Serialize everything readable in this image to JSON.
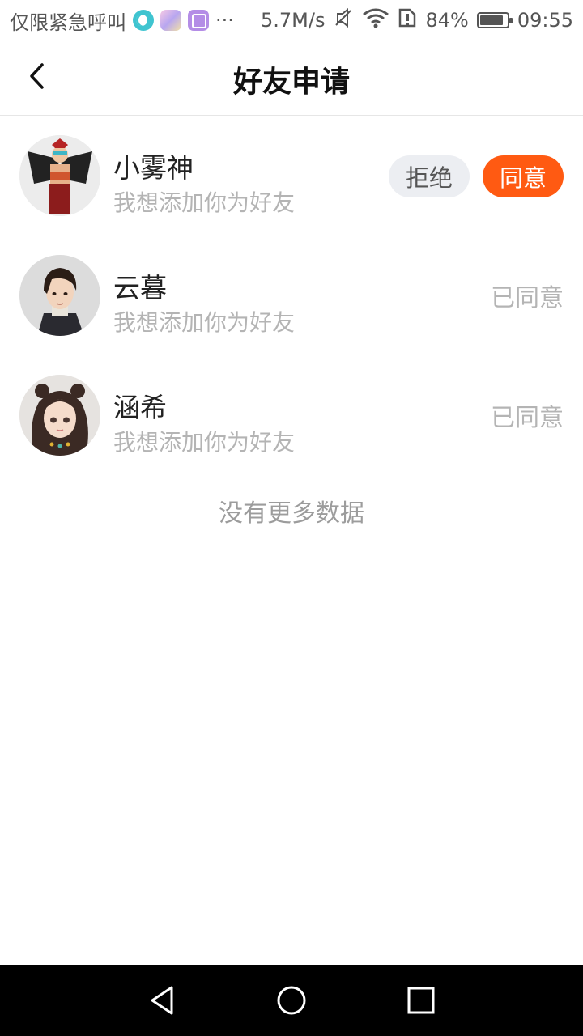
{
  "status_bar": {
    "carrier_text": "仅限紧急呼叫",
    "more_dots": "···",
    "speed": "5.7M/s",
    "battery_percent": "84%",
    "time": "09:55",
    "icons": [
      "moon-app-icon",
      "game-app-icon",
      "gallery-app-icon",
      "mute-icon",
      "wifi-icon",
      "sim-alert-icon",
      "battery-icon"
    ]
  },
  "header": {
    "title": "好友申请",
    "back_icon": "chevron-left-icon"
  },
  "requests": [
    {
      "name": "小雾神",
      "message": "我想添加你为好友",
      "state": "pending",
      "reject_label": "拒绝",
      "accept_label": "同意"
    },
    {
      "name": "云暮",
      "message": "我想添加你为好友",
      "state": "accepted",
      "status_label": "已同意"
    },
    {
      "name": "涵希",
      "message": "我想添加你为好友",
      "state": "accepted",
      "status_label": "已同意"
    }
  ],
  "footer_text": "没有更多数据",
  "nav_bar": {
    "icons": [
      "back-triangle-icon",
      "home-circle-icon",
      "recents-square-icon"
    ]
  },
  "colors": {
    "accent": "#ff5a12",
    "reject_bg": "#eceef2",
    "muted_text": "#b4b4b4"
  }
}
